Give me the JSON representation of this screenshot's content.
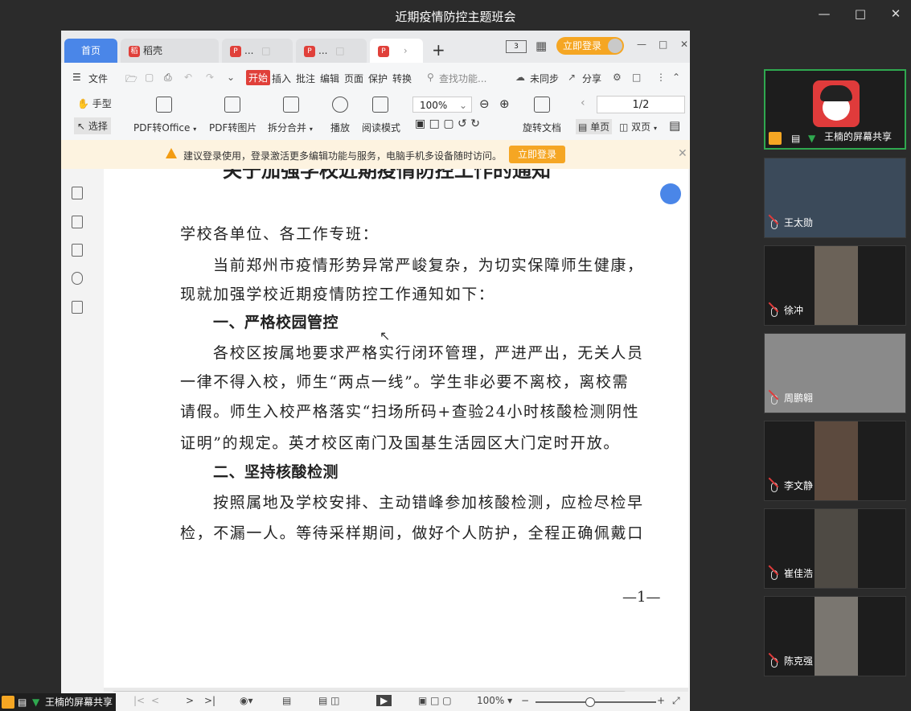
{
  "window": {
    "title": "近期疫情防控主题班会"
  },
  "wps": {
    "tabs": [
      {
        "label": "首页"
      },
      {
        "label": "稻壳"
      },
      {
        "label": "..."
      },
      {
        "label": "..."
      },
      {
        "label": ""
      }
    ],
    "new_tab": "+",
    "login_pill": "立即登录",
    "menu": [
      "文件",
      "开始",
      "插入",
      "批注",
      "编辑",
      "页面",
      "保护",
      "转换"
    ],
    "search_placeholder": "查找功能...",
    "sync_label": "未同步",
    "share_label": "分享",
    "ribbon": {
      "hand": "手型",
      "select": "选择",
      "pdf_to_office": "PDF转Office",
      "pdf_to_image": "PDF转图片",
      "split_merge": "拆分合并",
      "play": "播放",
      "read_mode": "阅读模式",
      "zoom": "100%",
      "rotate_doc": "旋转文档",
      "page_indicator": "1/2",
      "single_page": "单页",
      "double_page": "双页"
    },
    "notice": {
      "text": "建议登录使用，登录激活更多编辑功能与服务，电脑手机多设备随时访问。",
      "button": "立即登录"
    }
  },
  "document": {
    "heading": "关于加强学校近期疫情防控工作的通知",
    "salutation": "学校各单位、各工作专班：",
    "intro": [
      "当前郑州市疫情形势异常严峻复杂，为切实保障师生健康，",
      "现就加强学校近期疫情防控工作通知如下："
    ],
    "section1_title": "一、严格校园管控",
    "section1_lines": [
      "各校区按属地要求严格实行闭环管理，严进严出，无关人员",
      "一律不得入校，师生“两点一线”。学生非必要不离校，离校需",
      "请假。师生入校严格落实“扫场所码+查验24小时核酸检测阴性",
      "证明”的规定。英才校区南门及国基生活园区大门定时开放。"
    ],
    "section2_title": "二、坚持核酸检测",
    "section2_lines": [
      "按照属地及学校安排、主动错峰参加核酸检测，应检尽检早",
      "检，不漏一人。等待采样期间，做好个人防护，全程正确佩戴口"
    ],
    "page_number": "—1—"
  },
  "statusbar": {
    "zoom": "100%"
  },
  "meeting": {
    "screen_share_label": "王楠的屏幕共享",
    "participants": [
      {
        "name": "王楠的屏幕共享"
      },
      {
        "name": "王太勋"
      },
      {
        "name": "徐冲"
      },
      {
        "name": "周鹏翱"
      },
      {
        "name": "李文静"
      },
      {
        "name": "崔佳浩"
      },
      {
        "name": "陈克强"
      }
    ]
  }
}
